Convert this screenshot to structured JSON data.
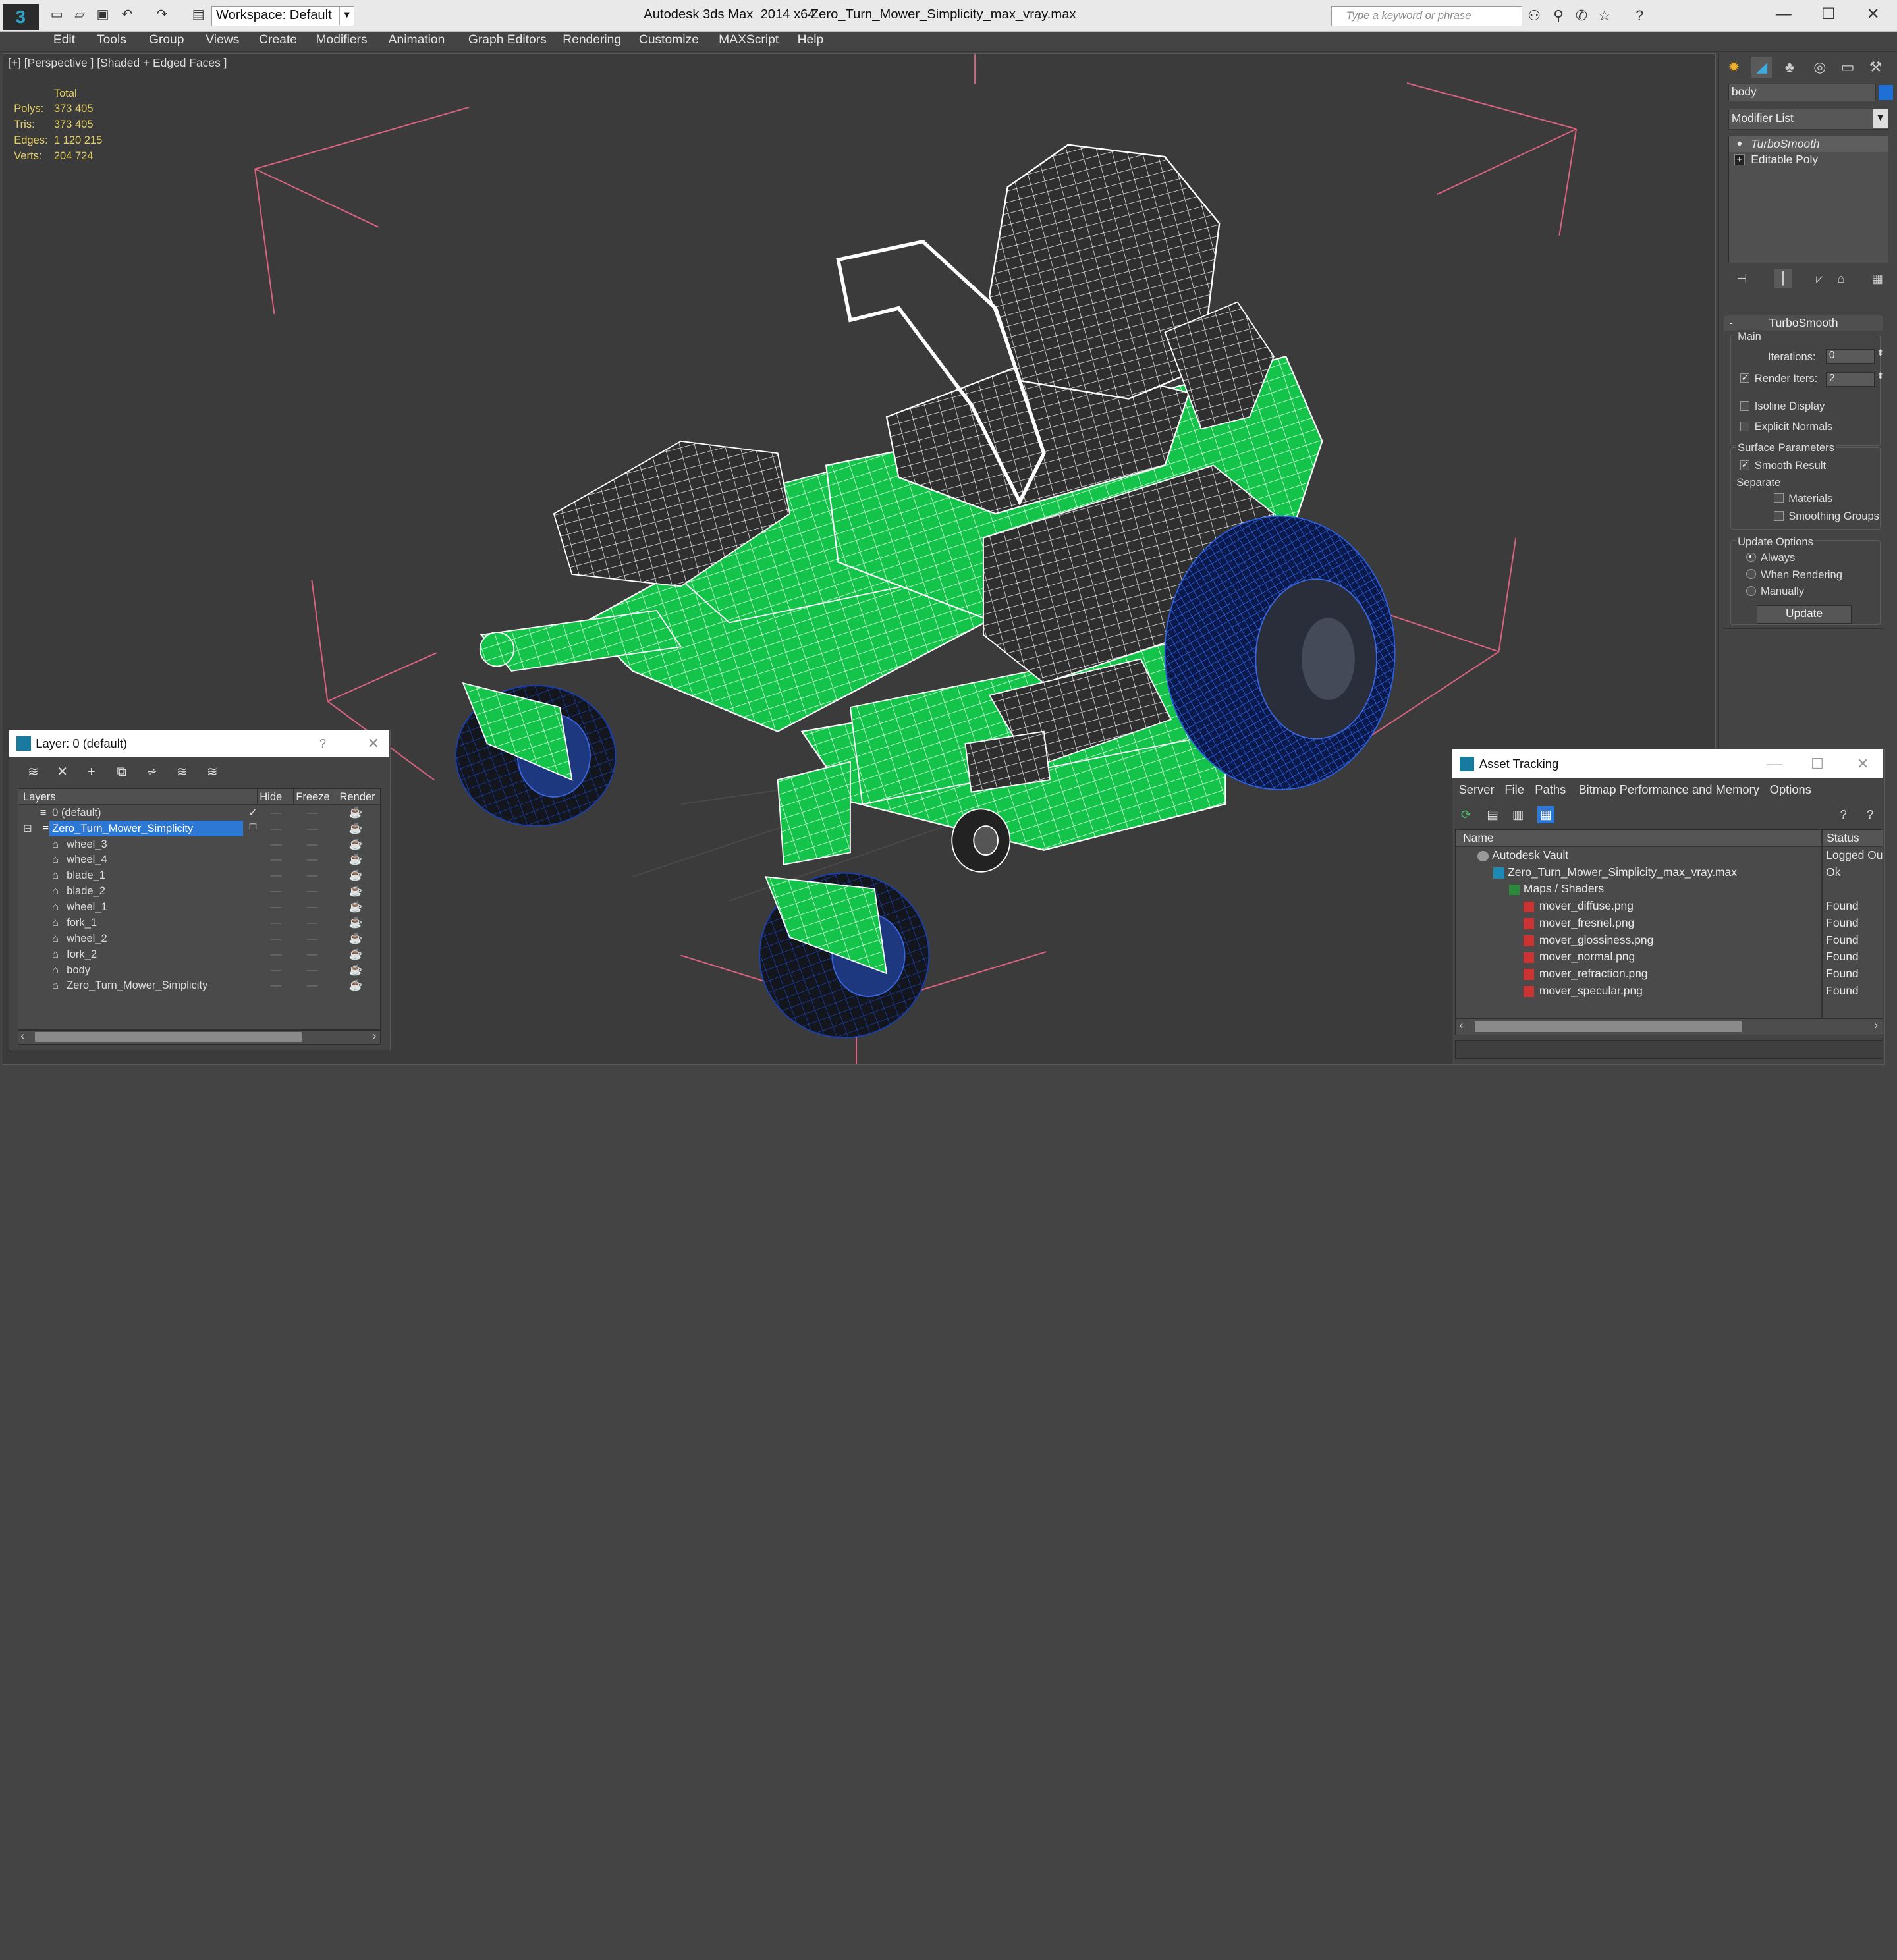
{
  "app": {
    "title": "Autodesk 3ds Max  2014 x64",
    "file": "Zero_Turn_Mower_Simplicity_max_vray.max",
    "workspace": "Workspace: Default",
    "search_placeholder": "Type a keyword or phrase"
  },
  "menu": [
    "Edit",
    "Tools",
    "Group",
    "Views",
    "Create",
    "Modifiers",
    "Animation",
    "Graph Editors",
    "Rendering",
    "Customize",
    "MAXScript",
    "Help"
  ],
  "viewport": {
    "label": "[+] [Perspective ] [Shaded + Edged Faces ]",
    "stats": {
      "total_label": "Total",
      "rows": [
        {
          "k": "Polys:",
          "v": "373 405"
        },
        {
          "k": "Tris:",
          "v": "373 405"
        },
        {
          "k": "Edges:",
          "v": "1 120 215"
        },
        {
          "k": "Verts:",
          "v": "204 724"
        }
      ]
    }
  },
  "command_panel": {
    "object_name": "body",
    "modifier_list": "Modifier List",
    "stack": [
      "TurboSmooth",
      "Editable Poly"
    ],
    "rollout_title": "TurboSmooth",
    "main_label": "Main",
    "iterations_label": "Iterations:",
    "iterations_value": "0",
    "render_iters_label": "Render Iters:",
    "render_iters_value": "2",
    "isoline_label": "Isoline Display",
    "explicit_label": "Explicit Normals",
    "surface_label": "Surface Parameters",
    "smooth_label": "Smooth Result",
    "separate_label": "Separate",
    "materials_label": "Materials",
    "smoothing_label": "Smoothing Groups",
    "update_options_label": "Update Options",
    "always_label": "Always",
    "when_rendering_label": "When Rendering",
    "manually_label": "Manually",
    "update_button": "Update",
    "accent_color": "#1e6fd6"
  },
  "layer_panel": {
    "title": "Layer: 0 (default)",
    "help": "?",
    "columns": [
      "Layers",
      "Hide",
      "Freeze",
      "Render"
    ],
    "rows": [
      {
        "name": "0 (default)",
        "level": 1,
        "checked": true
      },
      {
        "name": "Zero_Turn_Mower_Simplicity",
        "level": 1,
        "selected": true
      },
      {
        "name": "wheel_3",
        "level": 2
      },
      {
        "name": "wheel_4",
        "level": 2
      },
      {
        "name": "blade_1",
        "level": 2
      },
      {
        "name": "blade_2",
        "level": 2
      },
      {
        "name": "wheel_1",
        "level": 2
      },
      {
        "name": "fork_1",
        "level": 2
      },
      {
        "name": "wheel_2",
        "level": 2
      },
      {
        "name": "fork_2",
        "level": 2
      },
      {
        "name": "body",
        "level": 2
      },
      {
        "name": "Zero_Turn_Mower_Simplicity",
        "level": 2
      }
    ]
  },
  "asset_tracking": {
    "title": "Asset Tracking",
    "menu": [
      "Server",
      "File",
      "Paths",
      "Bitmap Performance and Memory",
      "Options"
    ],
    "columns": [
      "Name",
      "Status"
    ],
    "rows": [
      {
        "name": "Autodesk Vault",
        "status": "Logged Ou",
        "level": 1,
        "icon": "vault-icon"
      },
      {
        "name": "Zero_Turn_Mower_Simplicity_max_vray.max",
        "status": "Ok",
        "level": 2,
        "icon": "max-file-icon"
      },
      {
        "name": "Maps / Shaders",
        "status": "",
        "level": 3,
        "icon": "maps-icon"
      },
      {
        "name": "mover_diffuse.png",
        "status": "Found",
        "level": 4,
        "icon": "png-icon"
      },
      {
        "name": "mover_fresnel.png",
        "status": "Found",
        "level": 4,
        "icon": "png-icon"
      },
      {
        "name": "mover_glossiness.png",
        "status": "Found",
        "level": 4,
        "icon": "png-icon"
      },
      {
        "name": "mover_normal.png",
        "status": "Found",
        "level": 4,
        "icon": "png-icon"
      },
      {
        "name": "mover_refraction.png",
        "status": "Found",
        "level": 4,
        "icon": "png-icon"
      },
      {
        "name": "mover_specular.png",
        "status": "Found",
        "level": 4,
        "icon": "png-icon"
      }
    ]
  }
}
